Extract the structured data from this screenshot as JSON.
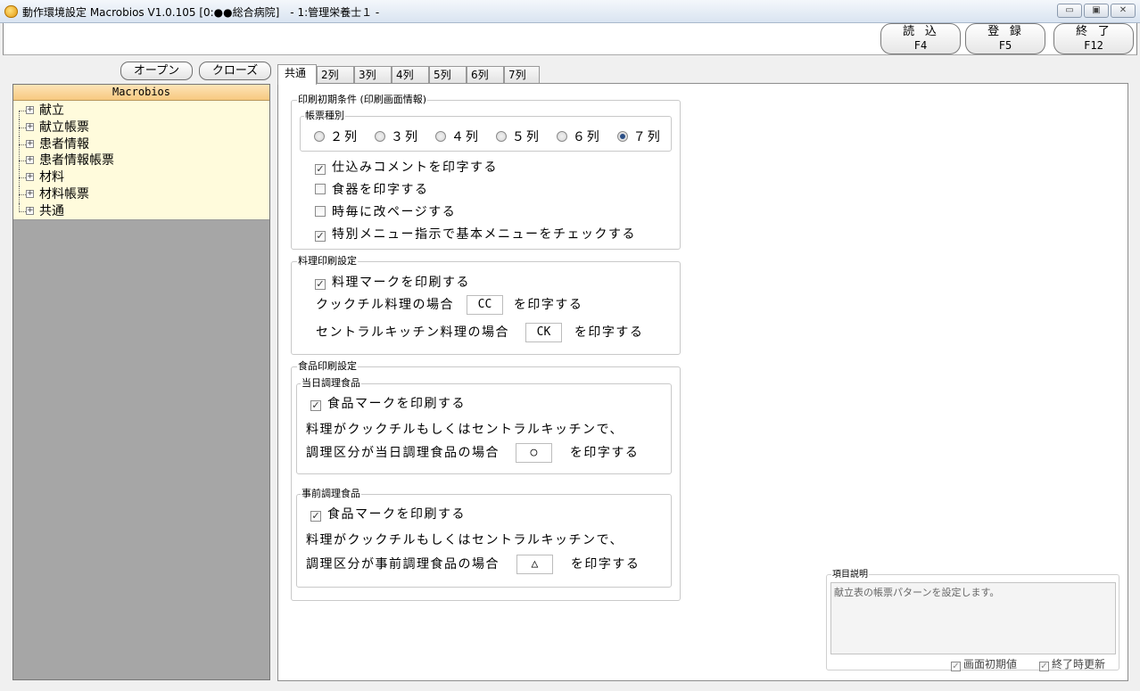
{
  "window": {
    "title": "動作環境設定 Macrobios V1.0.105 [0:●●総合病院]　- 1:管理栄養士１ -",
    "min_label": "▭",
    "max_label": "▣",
    "close_label": "✕"
  },
  "toolbar": {
    "read": {
      "label": "読 込",
      "key": "F4"
    },
    "save": {
      "label": "登 録",
      "key": "F5"
    },
    "exit": {
      "label": "終 了",
      "key": "F12"
    }
  },
  "left": {
    "open_label": "オープン",
    "close_label": "クローズ",
    "tree_header": "Macrobios",
    "tree_items": [
      "献立",
      "献立帳票",
      "患者情報",
      "患者情報帳票",
      "材料",
      "材料帳票",
      "共通"
    ]
  },
  "tabs": [
    "共通",
    "2列",
    "3列",
    "4列",
    "5列",
    "6列",
    "7列"
  ],
  "print_init": {
    "legend": "印刷初期条件 (印刷画面情報)",
    "form_type": {
      "legend": "帳票種別",
      "options": [
        "２列",
        "３列",
        "４列",
        "５列",
        "６列",
        "７列"
      ],
      "selected": "７列"
    },
    "checks": [
      {
        "label": "仕込みコメントを印字する",
        "checked": true
      },
      {
        "label": "食器を印字する",
        "checked": false
      },
      {
        "label": "時毎に改ページする",
        "checked": false
      },
      {
        "label": "特別メニュー指示で基本メニューをチェックする",
        "checked": true
      }
    ]
  },
  "dish_print": {
    "legend": "料理印刷設定",
    "mark_check": {
      "label": "料理マークを印刷する",
      "checked": true
    },
    "cookchill_label": "クックチル料理の場合",
    "cookchill_value": "CC",
    "central_label": "セントラルキッチン料理の場合",
    "central_value": "CK",
    "suffix": "を印字する"
  },
  "food_print": {
    "legend": "食品印刷設定",
    "sameday": {
      "legend": "当日調理食品",
      "mark_check": {
        "label": "食品マークを印刷する",
        "checked": true
      },
      "line1": "料理がクックチルもしくはセントラルキッチンで、",
      "line2": "調理区分が当日調理食品の場合",
      "value": "○",
      "suffix": "を印字する"
    },
    "advance": {
      "legend": "事前調理食品",
      "mark_check": {
        "label": "食品マークを印刷する",
        "checked": true
      },
      "line1": "料理がクックチルもしくはセントラルキッチンで、",
      "line2": "調理区分が事前調理食品の場合",
      "value": "△",
      "suffix": "を印字する"
    }
  },
  "description": {
    "legend": "項目説明",
    "text": "献立表の帳票パターンを設定します。",
    "initial_label": "画面初期値",
    "update_label": "終了時更新"
  },
  "check_mark": "✓"
}
